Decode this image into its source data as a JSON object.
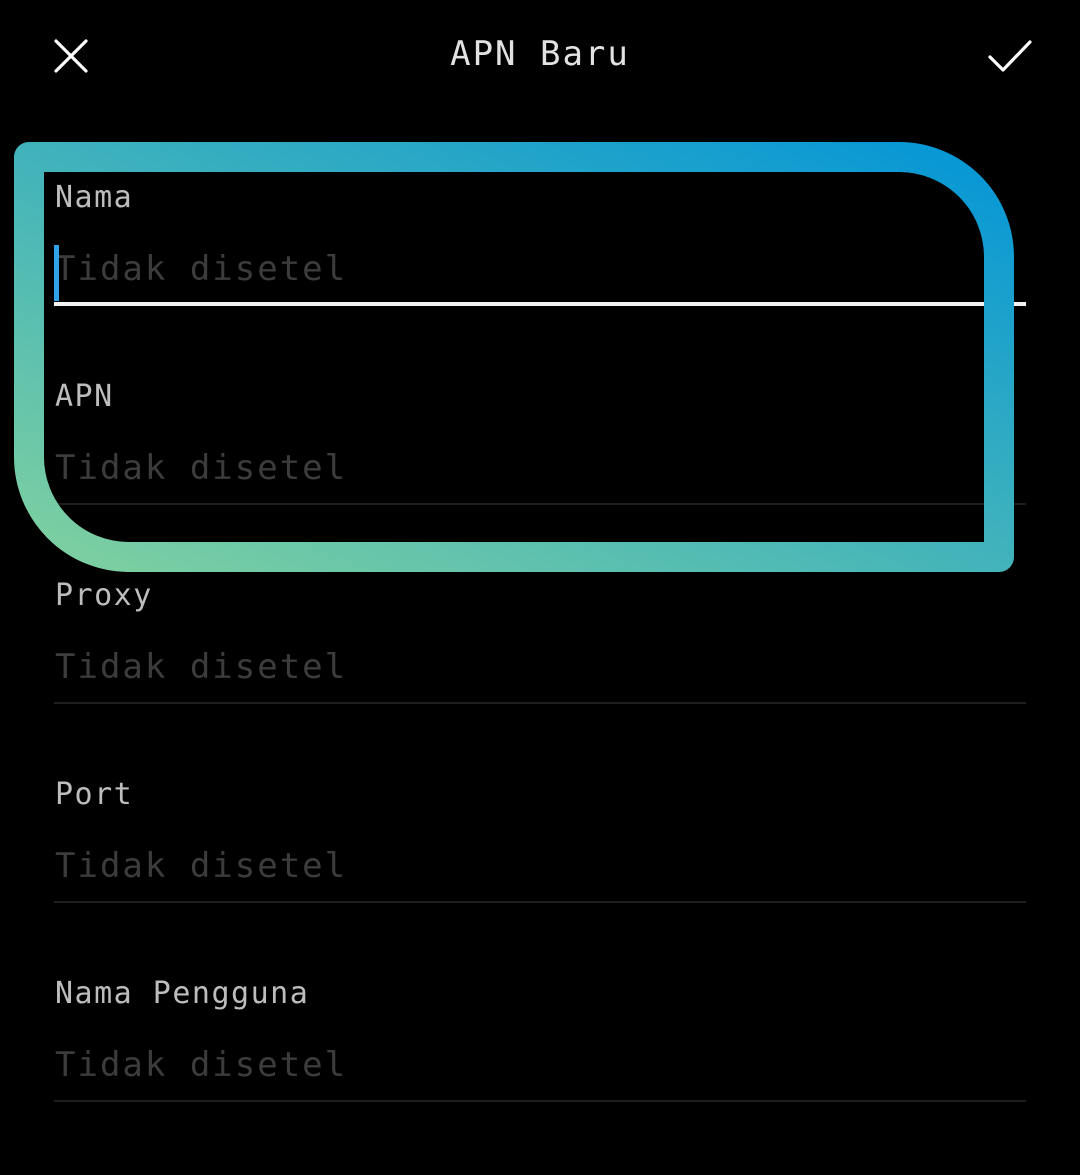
{
  "header": {
    "title": "APN Baru",
    "close_icon": "close-icon",
    "confirm_icon": "checkmark-icon"
  },
  "fields": [
    {
      "label": "Nama",
      "placeholder": "Tidak disetel",
      "value": "",
      "active": true
    },
    {
      "label": "APN",
      "placeholder": "Tidak disetel",
      "value": ""
    },
    {
      "label": "Proxy",
      "placeholder": "Tidak disetel",
      "value": ""
    },
    {
      "label": "Port",
      "placeholder": "Tidak disetel",
      "value": ""
    },
    {
      "label": "Nama Pengguna",
      "placeholder": "Tidak disetel",
      "value": ""
    }
  ],
  "colors": {
    "background": "#000000",
    "caret": "#2ea3ea",
    "highlight_gradient_start": "#7ed0a0",
    "highlight_gradient_end": "#0596d6"
  }
}
